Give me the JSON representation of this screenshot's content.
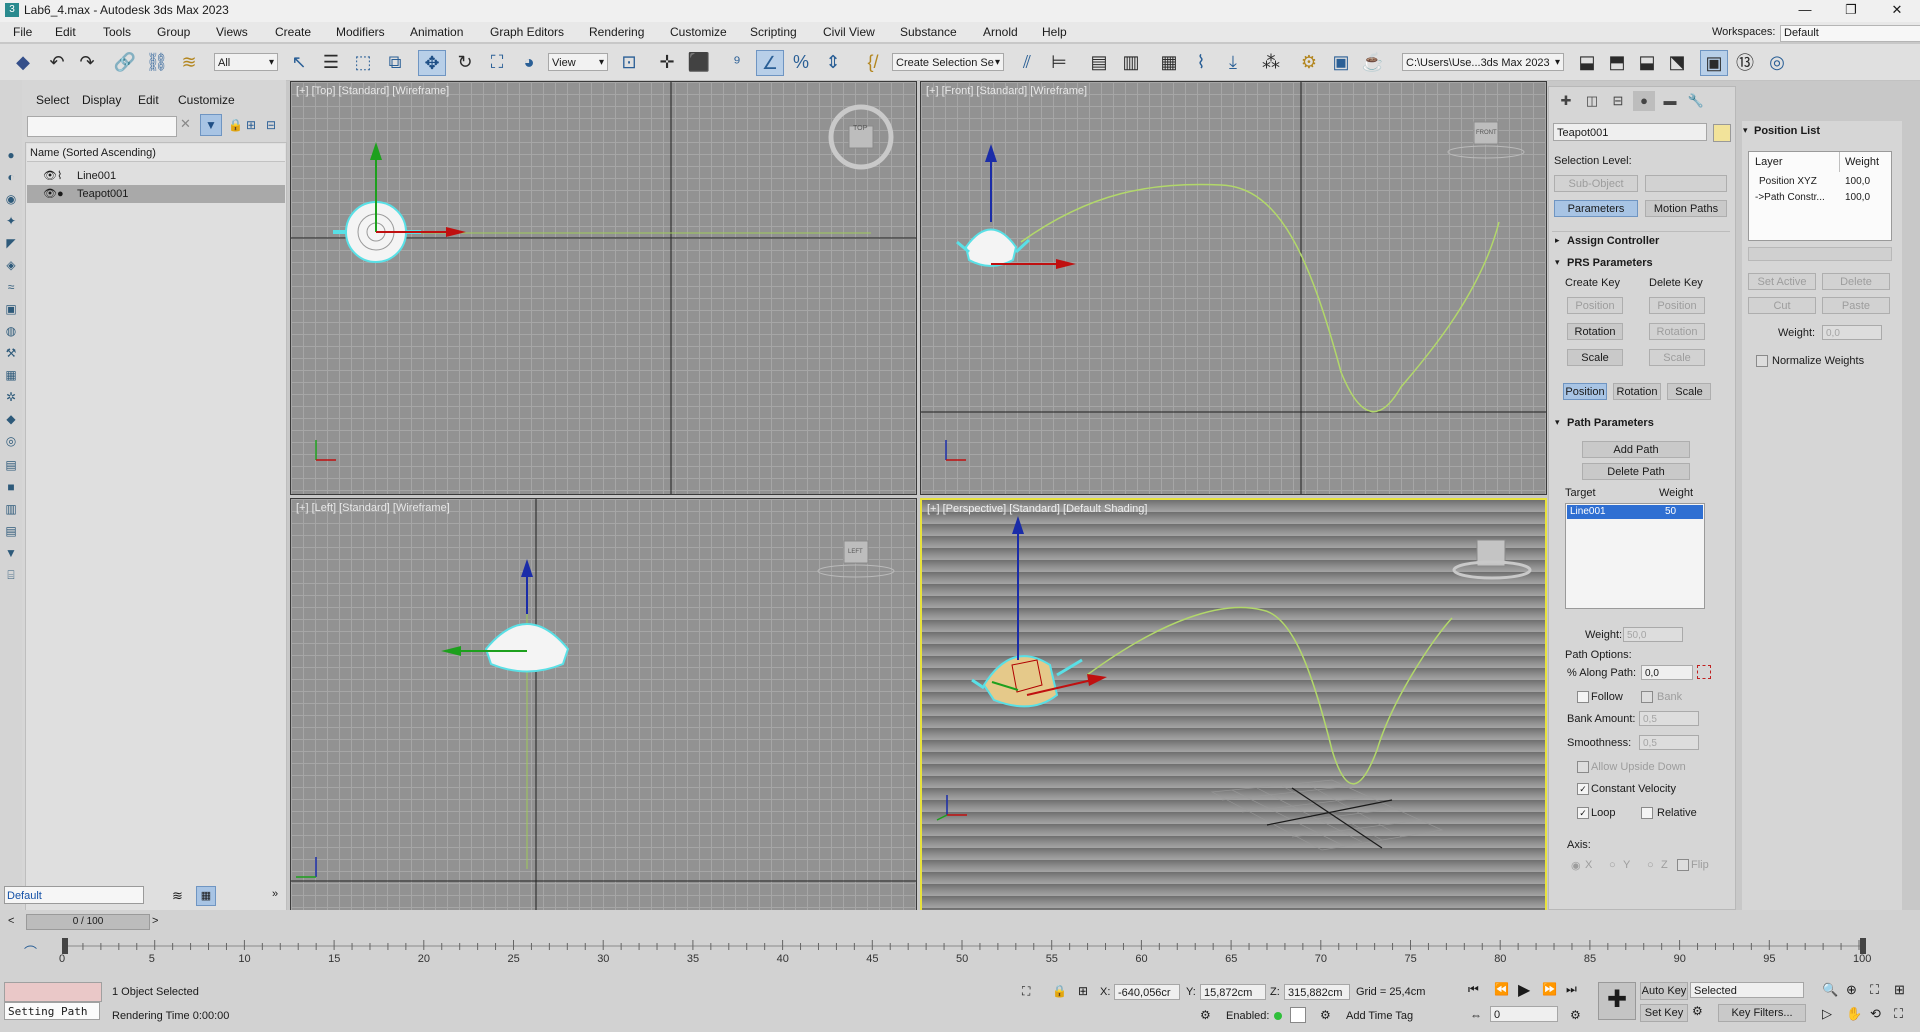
{
  "window": {
    "title": "Lab6_4.max - Autodesk 3ds Max 2023",
    "min": "—",
    "max": "❐",
    "close": "✕"
  },
  "menu": [
    "File",
    "Edit",
    "Tools",
    "Group",
    "Views",
    "Create",
    "Modifiers",
    "Animation",
    "Graph Editors",
    "Rendering",
    "Customize",
    "Scripting",
    "Civil View",
    "Substance",
    "Arnold",
    "Help"
  ],
  "workspaces": {
    "label": "Workspaces:",
    "value": "Default"
  },
  "toolbar": {
    "selection_filter": "All",
    "ref_coord": "View",
    "selection_set": "Create Selection Se",
    "project_path": "C:\\Users\\Use...3ds Max 2023"
  },
  "explorer": {
    "tabs": [
      "Select",
      "Display",
      "Edit",
      "Customize"
    ],
    "header": "Name (Sorted Ascending)",
    "rows": [
      "Line001",
      "Teapot001"
    ],
    "layer": "Default"
  },
  "viewports": {
    "top": "[+] [Top] [Standard] [Wireframe]",
    "front": "[+] [Front] [Standard] [Wireframe]",
    "left": "[+] [Left] [Standard] [Wireframe]",
    "persp": "[+] [Perspective] [Standard] [Default Shading]",
    "cube_top": "TOP",
    "cube_front": "FRONT",
    "cube_left": "LEFT"
  },
  "command_panel": {
    "object_name": "Teapot001",
    "object_color": "#f2e39a",
    "selection_level": "Selection Level:",
    "sub_object": "Sub-Object",
    "tab_parameters": "Parameters",
    "tab_motion_paths": "Motion Paths",
    "assign_controller": "Assign Controller",
    "prs_parameters": "PRS Parameters",
    "create_key": "Create Key",
    "delete_key": "Delete Key",
    "key_position": "Position",
    "key_rotation": "Rotation",
    "key_scale": "Scale",
    "prs_tabs": [
      "Position",
      "Rotation",
      "Scale"
    ],
    "path_parameters": "Path Parameters",
    "add_path": "Add Path",
    "delete_path": "Delete Path",
    "target_col": "Target",
    "weight_col": "Weight",
    "target_name": "Line001",
    "target_weight": "50",
    "weight_label": "Weight:",
    "weight_value": "50,0",
    "path_options": "Path Options:",
    "along_path_label": "% Along Path:",
    "along_path_value": "0,0",
    "follow": "Follow",
    "bank": "Bank",
    "bank_amount_label": "Bank Amount:",
    "bank_amount_value": "0,5",
    "smoothness_label": "Smoothness:",
    "smoothness_value": "0,5",
    "allow_upside_down": "Allow Upside Down",
    "constant_velocity": "Constant Velocity",
    "loop": "Loop",
    "relative": "Relative",
    "axis_label": "Axis:",
    "axis_options": [
      "X",
      "Y",
      "Z"
    ],
    "flip": "Flip"
  },
  "position_list": {
    "title": "Position List",
    "col_layer": "Layer",
    "col_weight": "Weight",
    "rows": [
      {
        "layer": "Position XYZ",
        "weight": "100,0"
      },
      {
        "layer": "->Path Constr...",
        "weight": "100,0"
      }
    ],
    "set_active": "Set Active",
    "delete": "Delete",
    "cut": "Cut",
    "paste": "Paste",
    "weight_label": "Weight:",
    "weight_value": "0,0",
    "normalize": "Normalize Weights"
  },
  "timeline": {
    "frame": "0 / 100",
    "ticks": [
      0,
      5,
      10,
      15,
      20,
      25,
      30,
      35,
      40,
      45,
      50,
      55,
      60,
      65,
      70,
      75,
      80,
      85,
      90,
      95,
      100
    ]
  },
  "status": {
    "script_line": "Setting Path",
    "selected": "1 Object Selected",
    "render_time": "Rendering Time  0:00:00",
    "x_label": "X:",
    "x_value": "-640,056cr",
    "y_label": "Y:",
    "y_value": "15,872cm",
    "z_label": "Z:",
    "z_value": "315,882cm",
    "grid": "Grid = 25,4cm",
    "enabled": "Enabled:",
    "add_time_tag": "Add Time Tag",
    "auto_key": "Auto Key",
    "selected_dd": "Selected",
    "set_key": "Set Key",
    "key_filters": "Key Filters...",
    "current_frame": "0"
  }
}
